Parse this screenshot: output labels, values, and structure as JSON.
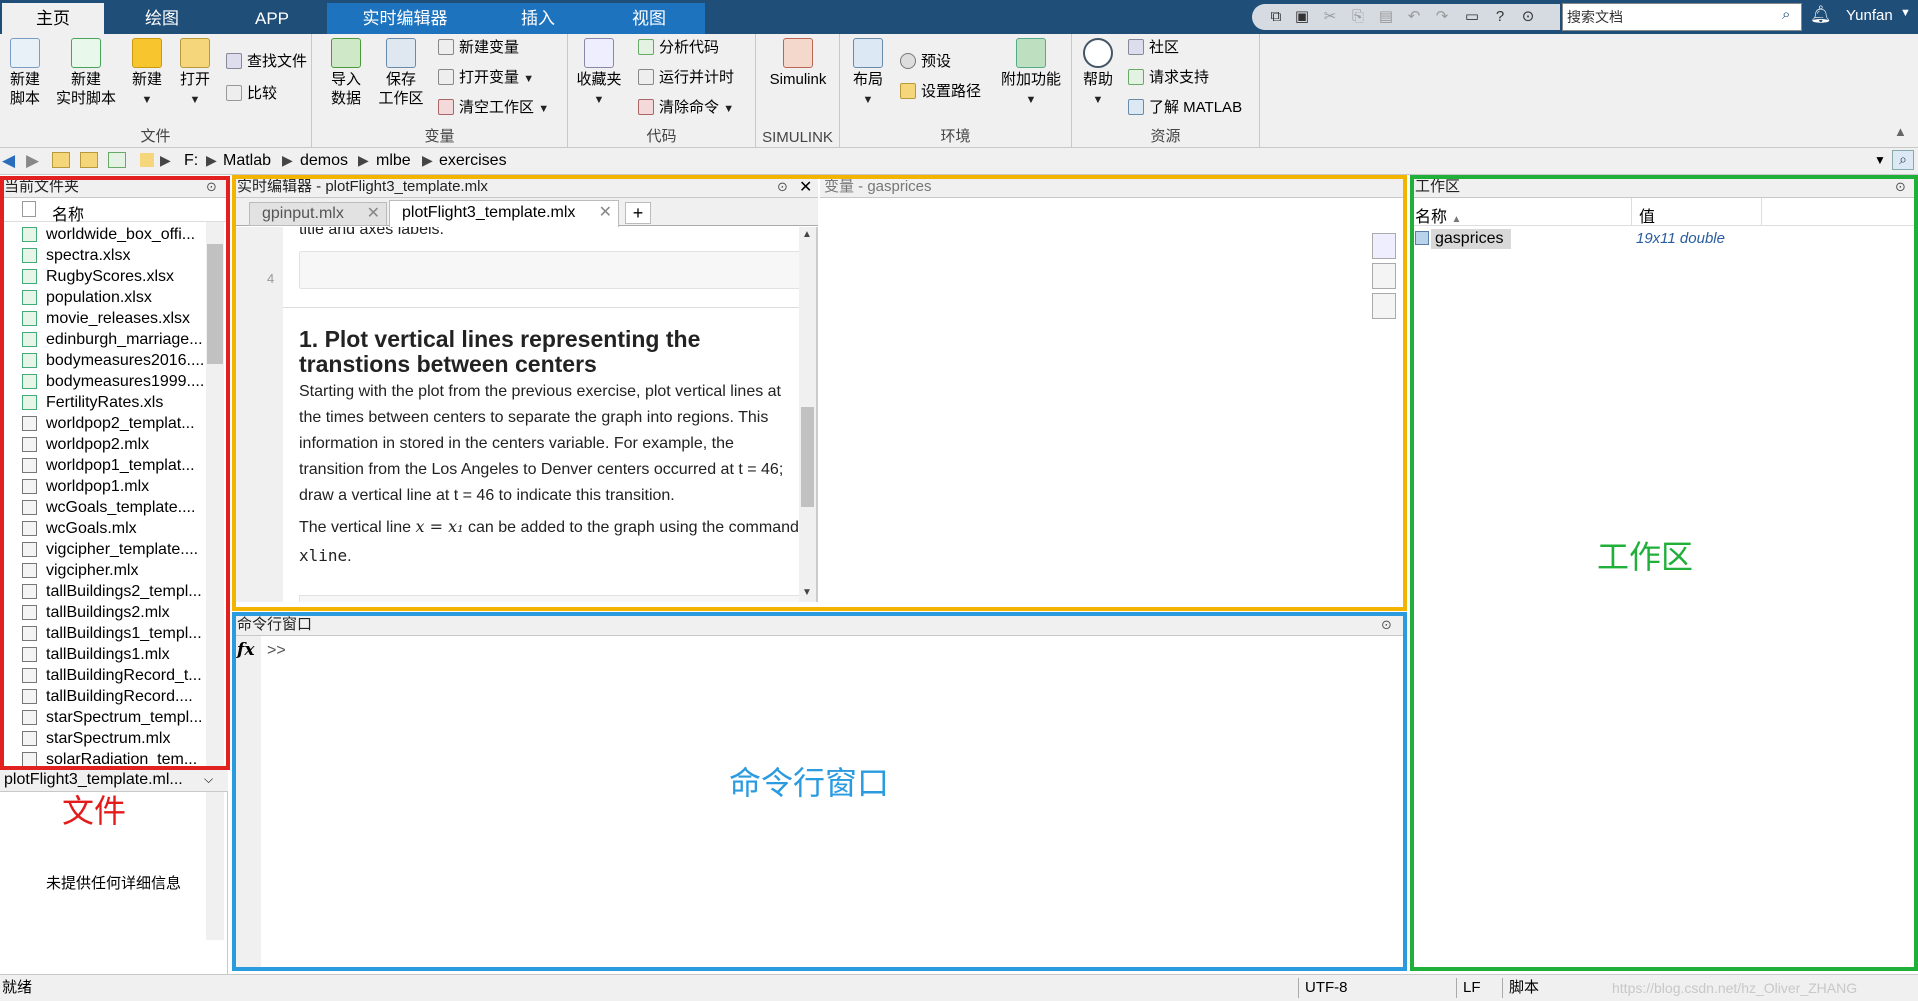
{
  "tabs": [
    "主页",
    "绘图",
    "APP",
    "实时编辑器",
    "插入",
    "视图"
  ],
  "search": {
    "placeholder": "搜索文档"
  },
  "user": "Yunfan",
  "ribbon": {
    "file": {
      "title": "文件",
      "new_script": "新建\n脚本",
      "new_live": "新建\n实时脚本",
      "new": "新建",
      "open": "打开",
      "find_files": "查找文件",
      "compare": "比较"
    },
    "variable": {
      "title": "变量",
      "import": "导入\n数据",
      "save_ws": "保存\n工作区",
      "new_var": "新建变量",
      "open_var": "打开变量",
      "clear_ws": "清空工作区"
    },
    "code": {
      "title": "代码",
      "favorites": "收藏夹",
      "analyze": "分析代码",
      "run_time": "运行并计时",
      "clear_cmd": "清除命令"
    },
    "simulink": {
      "title": "SIMULINK",
      "simulink": "Simulink"
    },
    "env": {
      "title": "环境",
      "layout": "布局",
      "prefs": "预设",
      "set_path": "设置路径",
      "addons": "附加功能"
    },
    "resources": {
      "title": "资源",
      "help": "帮助",
      "community": "社区",
      "support": "请求支持",
      "learn": "了解 MATLAB"
    }
  },
  "address": {
    "drive": "F:",
    "parts": [
      "Matlab",
      "demos",
      "mlbe",
      "exercises"
    ]
  },
  "current_folder": {
    "title": "当前文件夹",
    "column": "名称",
    "files": [
      "worldwide_box_offi...",
      "spectra.xlsx",
      "RugbyScores.xlsx",
      "population.xlsx",
      "movie_releases.xlsx",
      "edinburgh_marriage...",
      "bodymeasures2016....",
      "bodymeasures1999....",
      "FertilityRates.xls",
      "worldpop2_templat...",
      "worldpop2.mlx",
      "worldpop1_templat...",
      "worldpop1.mlx",
      "wcGoals_template....",
      "wcGoals.mlx",
      "vigcipher_template....",
      "vigcipher.mlx",
      "tallBuildings2_templ...",
      "tallBuildings2.mlx",
      "tallBuildings1_templ...",
      "tallBuildings1.mlx",
      "tallBuildingRecord_t...",
      "tallBuildingRecord....",
      "starSpectrum_templ...",
      "starSpectrum.mlx",
      "solarRadiation_tem..."
    ],
    "details_file": "plotFlight3_template.ml...",
    "details_text": "未提供任何详细信息",
    "label": "文件"
  },
  "editor": {
    "title": "实时编辑器 - plotFlight3_template.mlx",
    "var_title": "变量 - gasprices",
    "tabs": [
      "gpinput.mlx",
      "plotFlight3_template.mlx"
    ],
    "line_number": "4",
    "top_text": "title and axes labels.",
    "heading": "1. Plot vertical lines representing the transtions between centers",
    "para1": "Starting with the plot from the previous exercise, plot vertical lines at the times between centers to separate the graph into regions. This information in stored in the centers variable. For example, the transition from the Los Angeles to Denver centers occurred at t = 46; draw a vertical line at t = 46 to indicate this transition.",
    "para2_a": "The vertical line ",
    "para2_math": "x = x₁",
    "para2_b": " can be added to the graph using the command ",
    "para2_code": "xline",
    "para2_c": "."
  },
  "command_window": {
    "title": "命令行窗口",
    "prompt": ">>",
    "fx": "fx",
    "label": "命令行窗口"
  },
  "workspace": {
    "title": "工作区",
    "col_name": "名称",
    "col_value": "值",
    "vars": [
      {
        "name": "gasprices",
        "value": "19x11 double"
      }
    ],
    "label": "工作区"
  },
  "status": {
    "ready": "就绪",
    "encoding": "UTF-8",
    "eol": "LF",
    "type": "脚本",
    "watermark": "https://blog.csdn.net/hz_Oliver_ZHANG"
  }
}
